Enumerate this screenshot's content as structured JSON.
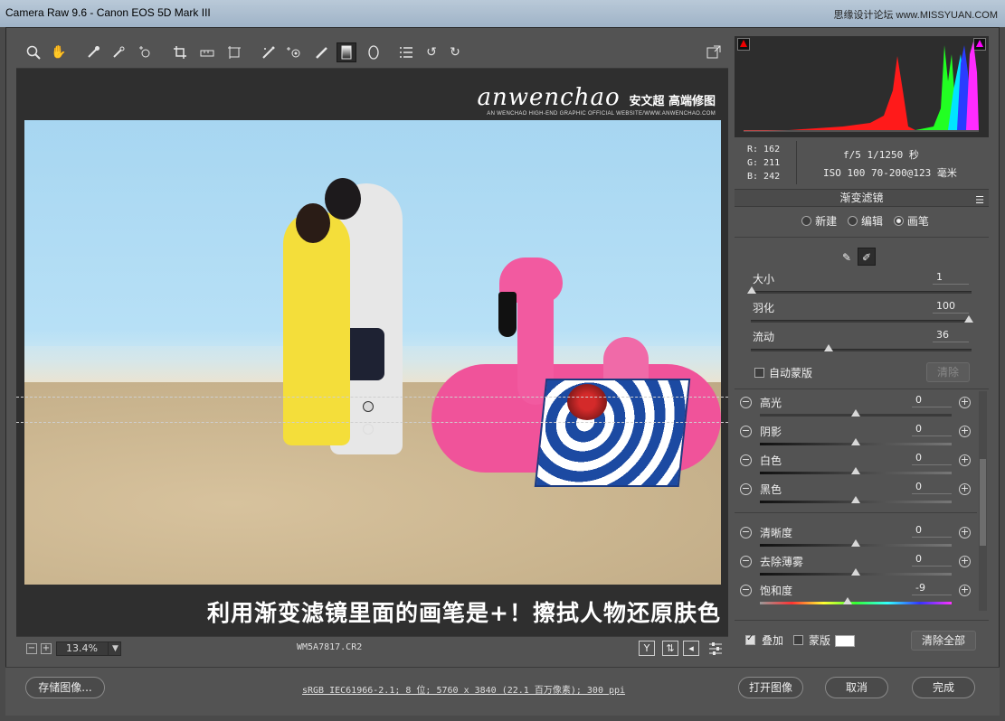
{
  "window": {
    "title": "Camera Raw 9.6 -  Canon EOS 5D Mark III",
    "watermark": "思缘设计论坛 www.MISSYUAN.COM"
  },
  "toolbar": {
    "tools": [
      "zoom-icon",
      "hand-icon",
      "white-balance-icon",
      "color-sampler-icon",
      "targeted-adjust-icon",
      "crop-icon",
      "straighten-icon",
      "transform-icon",
      "spot-removal-icon",
      "red-eye-icon",
      "adjustment-brush-icon",
      "graduated-filter-icon",
      "radial-filter-icon",
      "preferences-icon",
      "rotate-left-icon",
      "rotate-right-icon"
    ],
    "fullscreen_icon": "fullscreen-icon"
  },
  "logo": {
    "brand": "anwenchao",
    "brand_cn": "安文超 高端修图",
    "sub": "AN WENCHAO HIGH-END GRAPHIC OFFICIAL WEBSITE/WWW.ANWENCHAO.COM"
  },
  "caption": "利用渐变滤镜里面的画笔是+！擦拭人物还原肤色",
  "statusbar": {
    "zoom": "13.4%",
    "filename": "WM5A7817.CR2",
    "icons": [
      "y-compare-icon",
      "swap-icon",
      "copy-icon",
      "settings-icon"
    ]
  },
  "histogram": {
    "colors": {
      "red": "#ff1a1a",
      "green": "#22ff22",
      "cyan": "#00e5ff",
      "blue": "#2a3cff",
      "magenta": "#ff2bff",
      "white": "#ffffff"
    }
  },
  "readout": {
    "r": "R:  162",
    "g": "G:  211",
    "b": "B:  242",
    "exif1": "f/5   1/1250 秒",
    "exif2": "ISO 100   70-200@123 毫米"
  },
  "panel": {
    "title": "渐变滤镜",
    "modes": {
      "new": "新建",
      "edit": "编辑",
      "brush": "画笔"
    },
    "size": {
      "label": "大小",
      "value": "1"
    },
    "feather": {
      "label": "羽化",
      "value": "100"
    },
    "flow": {
      "label": "流动",
      "value": "36"
    },
    "auto_mask": "自动蒙版",
    "clear": "清除",
    "adjustments": [
      {
        "label": "高光",
        "value": "0"
      },
      {
        "label": "阴影",
        "value": "0"
      },
      {
        "label": "白色",
        "value": "0"
      },
      {
        "label": "黑色",
        "value": "0"
      },
      {
        "label": "清晰度",
        "value": "0"
      },
      {
        "label": "去除薄雾",
        "value": "0"
      },
      {
        "label": "饱和度",
        "value": "-9"
      }
    ],
    "overlay": "叠加",
    "mask": "蒙版",
    "clear_all": "清除全部"
  },
  "footer": {
    "save": "存储图像...",
    "info": "sRGB IEC61966-2.1; 8 位; 5760 x 3840 (22.1 百万像素); 300 ppi",
    "open": "打开图像",
    "cancel": "取消",
    "done": "完成"
  }
}
